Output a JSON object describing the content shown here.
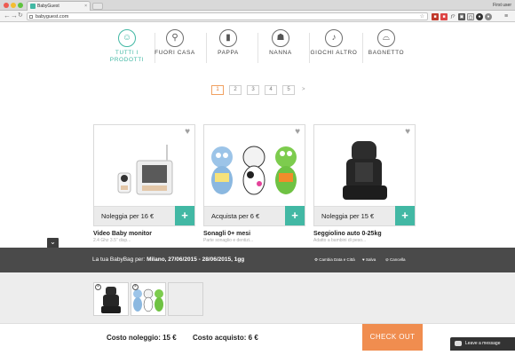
{
  "browser": {
    "tab_title": "BabyGuest",
    "url": "babyguest.com",
    "user_label": "First user",
    "extension_icons": [
      "icon-1",
      "icon-2",
      "f?",
      "icon-4",
      "icon-5",
      "icon-6",
      "icon-7",
      "menu"
    ]
  },
  "categories": [
    {
      "line1": "TUTTI I",
      "line2": "PRODOTTI",
      "icon": "baby-face-icon",
      "active": true
    },
    {
      "line1": "FUORI CASA",
      "line2": "",
      "icon": "stroller-icon",
      "active": false
    },
    {
      "line1": "PAPPA",
      "line2": "",
      "icon": "bottle-icon",
      "active": false
    },
    {
      "line1": "NANNA",
      "line2": "",
      "icon": "crib-icon",
      "active": false
    },
    {
      "line1": "GIOCHI ALTRO",
      "line2": "",
      "icon": "rattle-icon",
      "active": false
    },
    {
      "line1": "BAGNETTO",
      "line2": "",
      "icon": "bathtub-icon",
      "active": false
    }
  ],
  "pagination": {
    "pages": [
      "1",
      "2",
      "3",
      "4",
      "5"
    ],
    "current": "1",
    "next": ">"
  },
  "products": [
    {
      "action_price": "Noleggia per 16 €",
      "name": "Video Baby monitor",
      "desc": "2.4 Ghz 3.5\" disp..."
    },
    {
      "action_price": "Acquista per 6 €",
      "name": "Sonagli 0+ mesi",
      "desc": "Parte sonaglio e dentizi..."
    },
    {
      "action_price": "Noleggia per 15 €",
      "name": "Seggiolino auto 0-25kg",
      "desc": "Adatto a bambini di peso..."
    }
  ],
  "bag": {
    "title_prefix": "La tua BabyBag per:",
    "title_value": "Milano, 27/06/2015 - 28/06/2015, 1gg",
    "actions": [
      "Cambia Data e Città",
      "Salva",
      "Cancella"
    ]
  },
  "totals": {
    "rent_cost": "Costo noleggio: 15 €",
    "buy_cost": "Costo acquisto: 6 €",
    "checkout": "CHECK OUT",
    "leave_message": "Leave a message"
  },
  "colors": {
    "accent": "#42b8a4",
    "checkout": "#f08d4f",
    "bag_bar": "#4a4a4a"
  }
}
